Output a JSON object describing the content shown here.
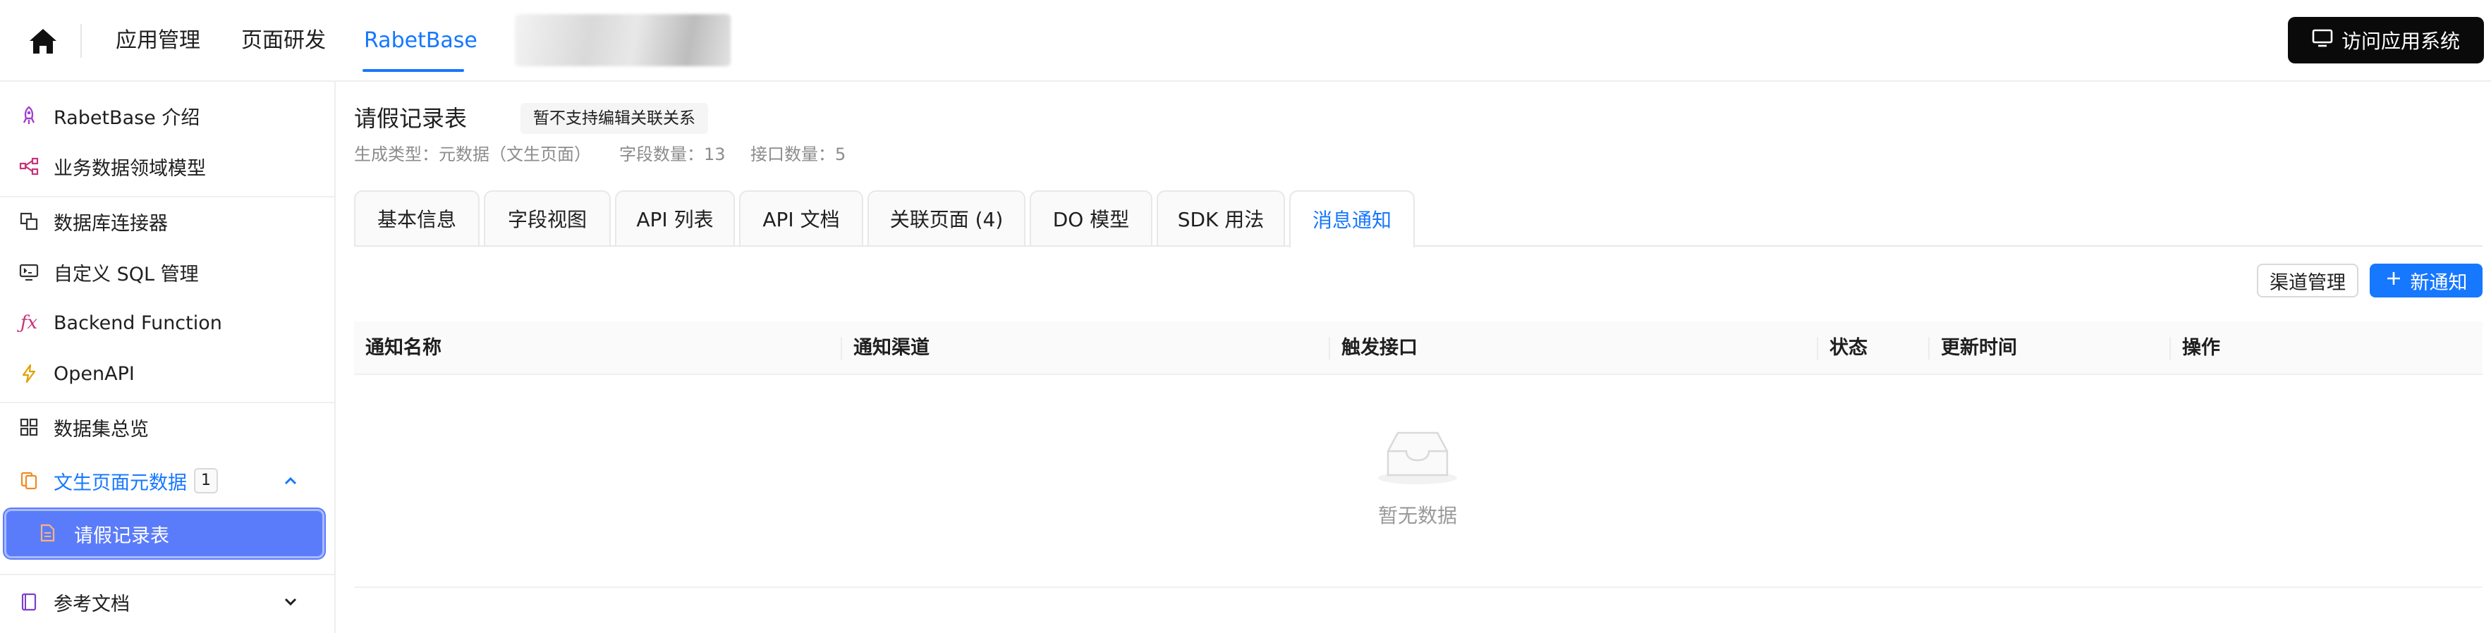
{
  "colors": {
    "accent": "#1677ff",
    "sidebar_active_bg": "#5b7cfa",
    "primary_button": "#1677ff",
    "visit_button": "#0a0a0a"
  },
  "topbar": {
    "home_icon": "home-icon",
    "nav": [
      "应用管理",
      "页面研发",
      "RabetBase"
    ],
    "active_nav": "RabetBase",
    "visit_button": "访问应用系统",
    "visit_icon": "monitor-icon"
  },
  "sidebar": {
    "items": [
      {
        "label": "RabetBase 介绍",
        "icon": "rocket-icon"
      },
      {
        "label": "业务数据领域模型",
        "icon": "model-graph-icon"
      },
      {
        "label": "数据库连接器",
        "icon": "copy-connector-icon"
      },
      {
        "label": "自定义 SQL 管理",
        "icon": "sql-monitor-icon"
      },
      {
        "label": "Backend Function",
        "icon": "fx-icon"
      },
      {
        "label": "OpenAPI",
        "icon": "lightning-icon"
      },
      {
        "label": "数据集总览",
        "icon": "grid-icon"
      },
      {
        "label": "文生页面元数据",
        "icon": "files-icon",
        "badge": "1",
        "expanded": true
      },
      {
        "label": "请假记录表",
        "icon": "file-icon",
        "selected": true
      },
      {
        "label": "参考文档",
        "icon": "book-icon",
        "expanded": false
      }
    ]
  },
  "main": {
    "title": "请假记录表",
    "tag": "暂不支持编辑关联关系",
    "meta": {
      "gen_type": "生成类型：元数据（文生页面）",
      "field_count": "字段数量：13",
      "api_count": "接口数量：5"
    },
    "tabs": [
      "基本信息",
      "字段视图",
      "API 列表",
      "API 文档",
      "关联页面 (4)",
      "DO 模型",
      "SDK 用法",
      "消息通知"
    ],
    "active_tab": "消息通知",
    "actions": {
      "channel_manage": "渠道管理",
      "new_notice": "新通知"
    },
    "table": {
      "columns": [
        "通知名称",
        "通知渠道",
        "触发接口",
        "状态",
        "更新时间",
        "操作"
      ],
      "rows": [],
      "empty_text": "暂无数据"
    }
  }
}
